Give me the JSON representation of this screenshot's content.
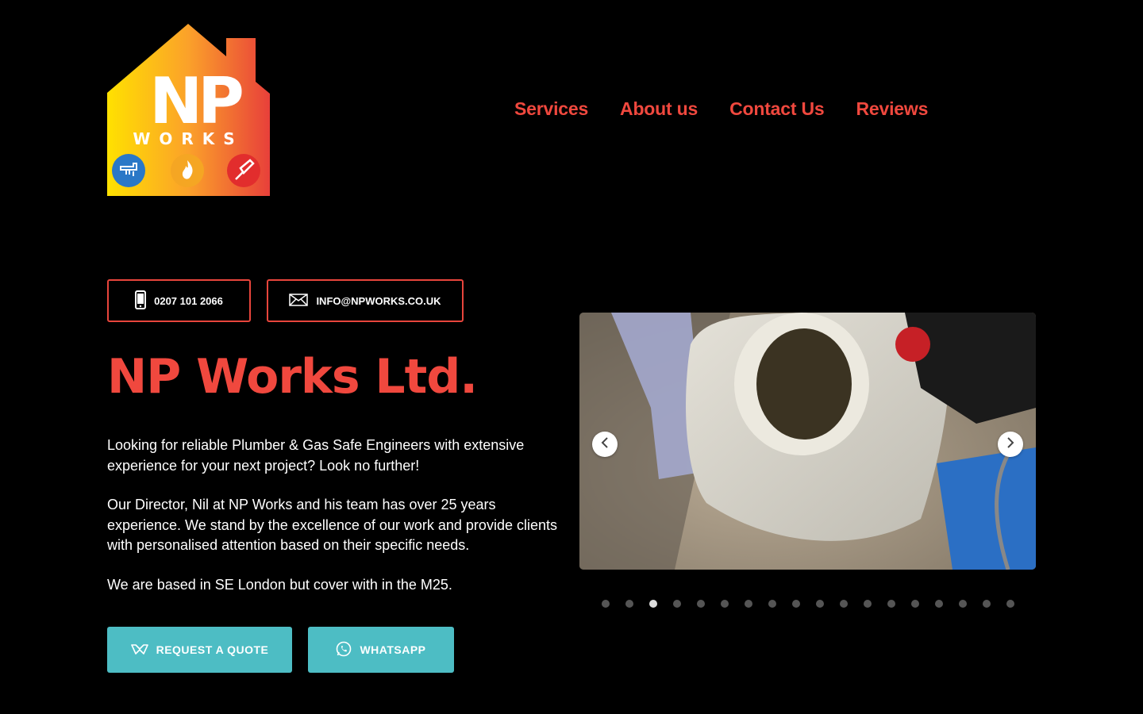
{
  "logo": {
    "letters": "NP",
    "subtitle": "WORKS",
    "icons": [
      "tap-icon",
      "flame-icon",
      "paintbrush-icon"
    ]
  },
  "nav": {
    "items": [
      {
        "label": "Services"
      },
      {
        "label": "About us"
      },
      {
        "label": "Contact Us"
      },
      {
        "label": "Reviews"
      }
    ]
  },
  "contact": {
    "phone": "0207 101 2066",
    "email": "INFO@NPWORKS.CO.UK"
  },
  "hero": {
    "title": "NP Works Ltd.",
    "paragraphs": [
      "Looking for reliable Plumber & Gas Safe Engineers with extensive experience for your next project? Look no further!",
      "Our Director, Nil at NP Works and his team has over 25 years experience. We stand by the excellence of our work and provide clients with personalised attention based on their specific needs.",
      "We are based in SE London but cover with in the M25."
    ]
  },
  "cta": {
    "quote": "REQUEST A QUOTE",
    "whatsapp": "WHATSAPP"
  },
  "slider": {
    "slide_count": 18,
    "active_index": 2
  },
  "colors": {
    "accent": "#f0483e",
    "button": "#4dbdc4",
    "background": "#000000"
  }
}
